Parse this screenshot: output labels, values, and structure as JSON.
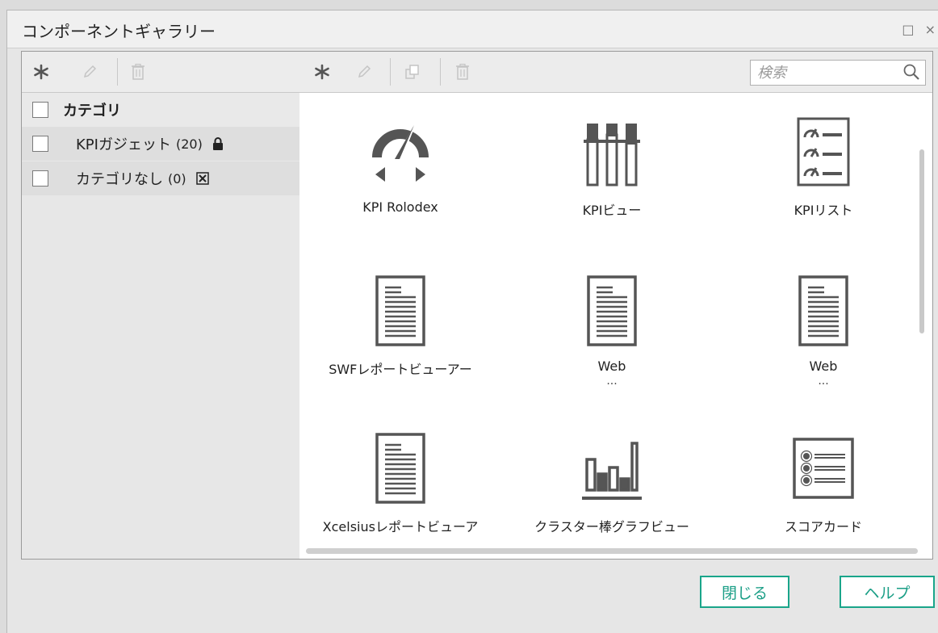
{
  "window": {
    "title": "コンポーネントギャラリー",
    "title_icons": "□ ×"
  },
  "left_toolbar": {
    "buttons": [
      "add-icon",
      "edit-icon",
      "delete-icon"
    ]
  },
  "right_toolbar": {
    "buttons": [
      "add-icon",
      "edit-icon",
      "copy-icon",
      "delete-icon"
    ]
  },
  "search": {
    "placeholder": "検索",
    "value": ""
  },
  "categories": {
    "header": "カテゴリ",
    "items": [
      {
        "label": "KPIガジェット",
        "suffix": "(20)",
        "icon": "lock-icon"
      },
      {
        "label": "カテゴリなし",
        "suffix": "(0)",
        "icon": "x-box-icon"
      }
    ]
  },
  "gallery": {
    "items": [
      {
        "label": "KPI Rolodex",
        "sub": "",
        "icon": "gauge-icon"
      },
      {
        "label": "KPIビュー",
        "sub": "",
        "icon": "kpi-view-icon"
      },
      {
        "label": "KPIリスト",
        "sub": "",
        "icon": "kpi-list-icon"
      },
      {
        "label": "SWFレポートビューアー",
        "sub": "",
        "icon": "document-icon"
      },
      {
        "label": "Web",
        "sub": "...",
        "icon": "document-icon"
      },
      {
        "label": "Web",
        "sub": "...",
        "icon": "document-icon"
      },
      {
        "label": "Xcelsiusレポートビューア",
        "sub": "",
        "icon": "document-icon"
      },
      {
        "label": "クラスター棒グラフビュー",
        "sub": "",
        "icon": "bar-chart-icon"
      },
      {
        "label": "スコアカード",
        "sub": "",
        "icon": "scorecard-icon"
      }
    ]
  },
  "footer": {
    "close_label": "閉じる",
    "help_label": "ヘルプ"
  },
  "colors": {
    "accent": "#1aa58a",
    "icon": "#555555"
  }
}
